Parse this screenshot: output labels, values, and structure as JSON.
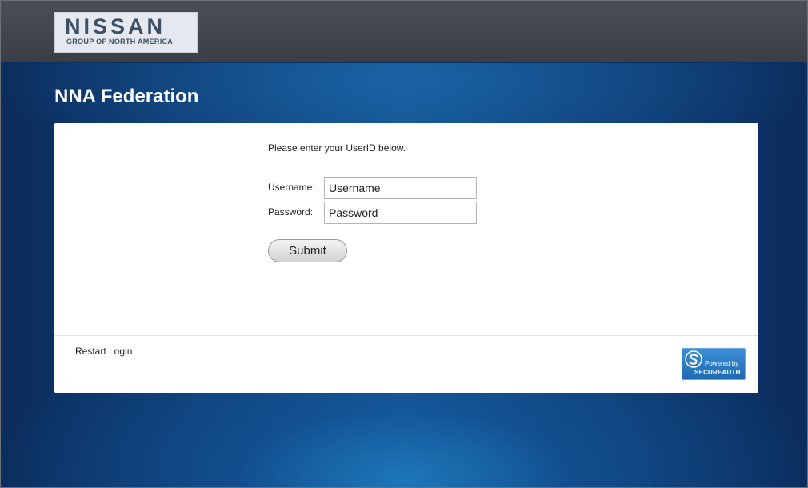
{
  "logo": {
    "main": "NISSAN",
    "sub": "GROUP OF NORTH AMERICA"
  },
  "page": {
    "title": "NNA Federation"
  },
  "form": {
    "instruction": "Please enter your UserID below.",
    "username_label": "Username:",
    "username_placeholder": "Username",
    "password_label": "Password:",
    "password_placeholder": "Password",
    "submit_label": "Submit"
  },
  "footer": {
    "restart_label": "Restart Login",
    "badge_powered": "Powered by",
    "badge_brand": "SECUREAUTH"
  },
  "colors": {
    "topbar": "#3f4349",
    "background_blue": "#14528f",
    "card": "#ffffff",
    "badge": "#2a7cc6"
  },
  "icons": {
    "badge_icon": "secureauth-s-icon"
  }
}
